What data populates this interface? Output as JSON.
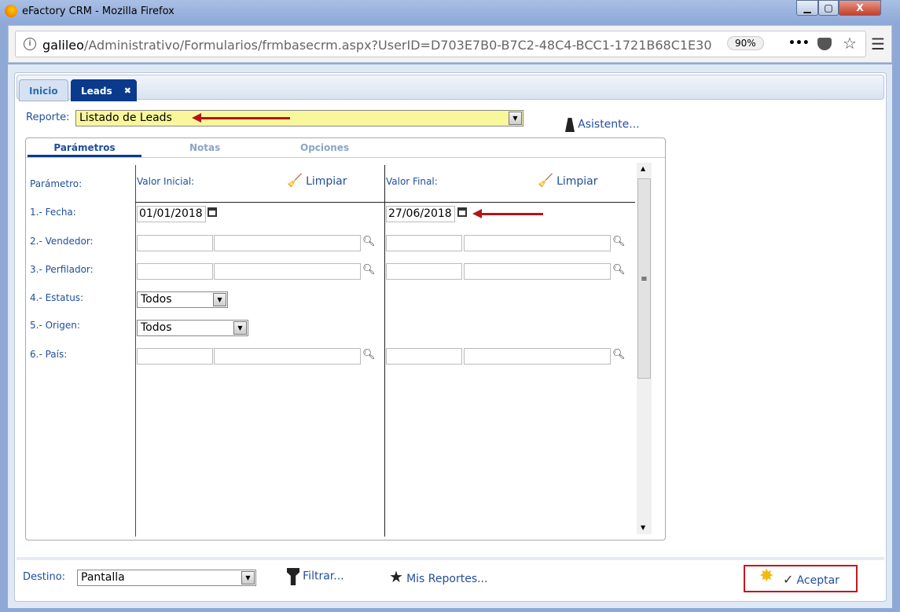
{
  "window": {
    "title": "eFactory CRM - Mozilla Firefox",
    "min": "▁",
    "max": "▢",
    "close": "X"
  },
  "browser": {
    "url_host": "galileo",
    "url_path": "/Administrativo/Formularios/frmbasecrm.aspx?UserID=D703E7B0-B7C2-48C4-BCC1-1721B68C1E30",
    "zoom": "90%",
    "more": "•••"
  },
  "tabs": [
    {
      "label": "Inicio"
    },
    {
      "label": "Leads",
      "close": "✖"
    }
  ],
  "reporte": {
    "label": "Reporte:",
    "value": "Listado de Leads",
    "asistente": "Asistente..."
  },
  "subtabs": [
    {
      "label": "Parámetros"
    },
    {
      "label": "Notas"
    },
    {
      "label": "Opciones"
    }
  ],
  "params": {
    "header_param": "Parámetro:",
    "header_inicial": "Valor Inicial:",
    "header_final": "Valor Final:",
    "limpiar": "Limpiar",
    "rows": [
      {
        "label": "1.- Fecha:",
        "start": "01/01/2018",
        "end": "27/06/2018"
      },
      {
        "label": "2.- Vendedor:"
      },
      {
        "label": "3.- Perfilador:"
      },
      {
        "label": "4.- Estatus:",
        "select": "Todos"
      },
      {
        "label": "5.- Origen:",
        "select": "Todos"
      },
      {
        "label": "6.- País:"
      }
    ]
  },
  "footer": {
    "destino_label": "Destino:",
    "destino": "Pantalla",
    "filtrar": "Filtrar...",
    "mis_reportes": "Mis Reportes...",
    "aceptar": "Aceptar"
  }
}
